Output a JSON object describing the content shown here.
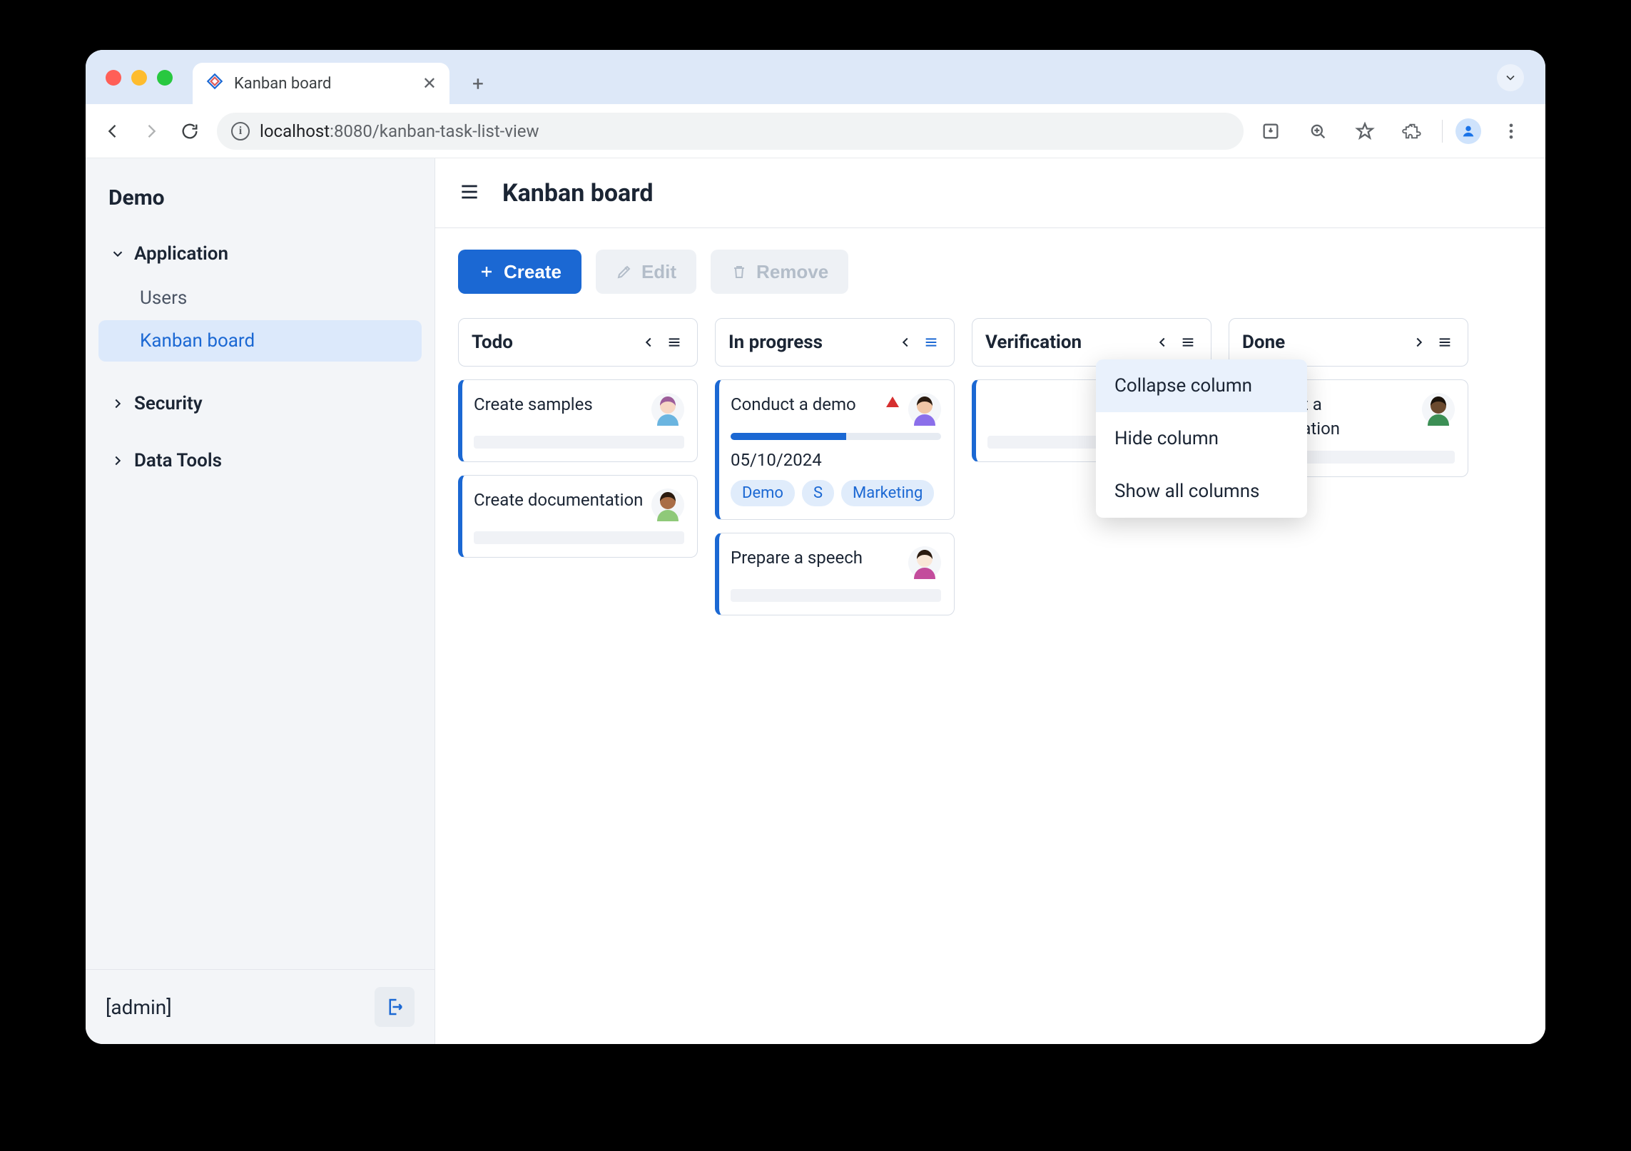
{
  "browser": {
    "tab_title": "Kanban board",
    "url_host": "localhost",
    "url_port": ":8080",
    "url_path": "/kanban-task-list-view"
  },
  "sidebar": {
    "brand": "Demo",
    "groups": [
      {
        "label": "Application",
        "expanded": true,
        "items": [
          {
            "label": "Users",
            "active": false
          },
          {
            "label": "Kanban board",
            "active": true
          }
        ]
      },
      {
        "label": "Security",
        "expanded": false,
        "items": []
      },
      {
        "label": "Data Tools",
        "expanded": false,
        "items": []
      }
    ],
    "user": "[admin]"
  },
  "header": {
    "title": "Kanban board"
  },
  "toolbar": {
    "create_label": "Create",
    "edit_label": "Edit",
    "remove_label": "Remove"
  },
  "board": {
    "columns": [
      {
        "title": "Todo",
        "menu_active": false,
        "arrow": "left",
        "cards": [
          {
            "title": "Create samples",
            "avatar": "f-pink",
            "flag": false,
            "progress": null,
            "date": null,
            "tags": [],
            "placeholder": true
          },
          {
            "title": "Create documentation",
            "avatar": "m-tan",
            "flag": false,
            "progress": null,
            "date": null,
            "tags": [],
            "placeholder": true
          }
        ]
      },
      {
        "title": "In progress",
        "menu_active": true,
        "arrow": "left",
        "cards": [
          {
            "title": "Conduct a demo",
            "avatar": "f-dark",
            "flag": true,
            "progress": 55,
            "date": "05/10/2024",
            "tags": [
              "Demo",
              "S",
              "Marketing"
            ],
            "placeholder": false
          },
          {
            "title": "Prepare a speech",
            "avatar": "f-pale",
            "flag": false,
            "progress": null,
            "date": null,
            "tags": [],
            "placeholder": true
          }
        ]
      },
      {
        "title": "Verification",
        "menu_active": false,
        "arrow": "left",
        "cards": [
          {
            "title": "",
            "avatar": "f-glasses",
            "flag": false,
            "progress": null,
            "date": null,
            "tags": [],
            "placeholder": true
          }
        ]
      },
      {
        "title": "Done",
        "menu_active": false,
        "arrow": "right",
        "cards": [
          {
            "title": "Conduct a presentation",
            "avatar": "m-dark",
            "flag": false,
            "progress": null,
            "date": null,
            "tags": [],
            "placeholder": true
          }
        ]
      }
    ]
  },
  "context_menu": {
    "items": [
      {
        "label": "Collapse column",
        "hover": true
      },
      {
        "label": "Hide column",
        "hover": false
      },
      {
        "label": "Show all columns",
        "hover": false
      }
    ]
  },
  "avatars": {
    "f-pink": {
      "skin": "#f7d7c4",
      "hair": "#9d5d9a",
      "shirt": "#6bb5e0"
    },
    "m-tan": {
      "skin": "#a96d46",
      "hair": "#2b1b10",
      "shirt": "#8fc979"
    },
    "f-dark": {
      "skin": "#f1c6a6",
      "hair": "#2b1b10",
      "shirt": "#8b6fea"
    },
    "f-pale": {
      "skin": "#f9e6d6",
      "hair": "#2b1b10",
      "shirt": "#c34c9c"
    },
    "f-glasses": {
      "skin": "#f7d7c4",
      "hair": "#2b1b10",
      "shirt": "#e46a5a"
    },
    "m-dark": {
      "skin": "#6b4a2f",
      "hair": "#1a120a",
      "shirt": "#3c8f55"
    }
  }
}
